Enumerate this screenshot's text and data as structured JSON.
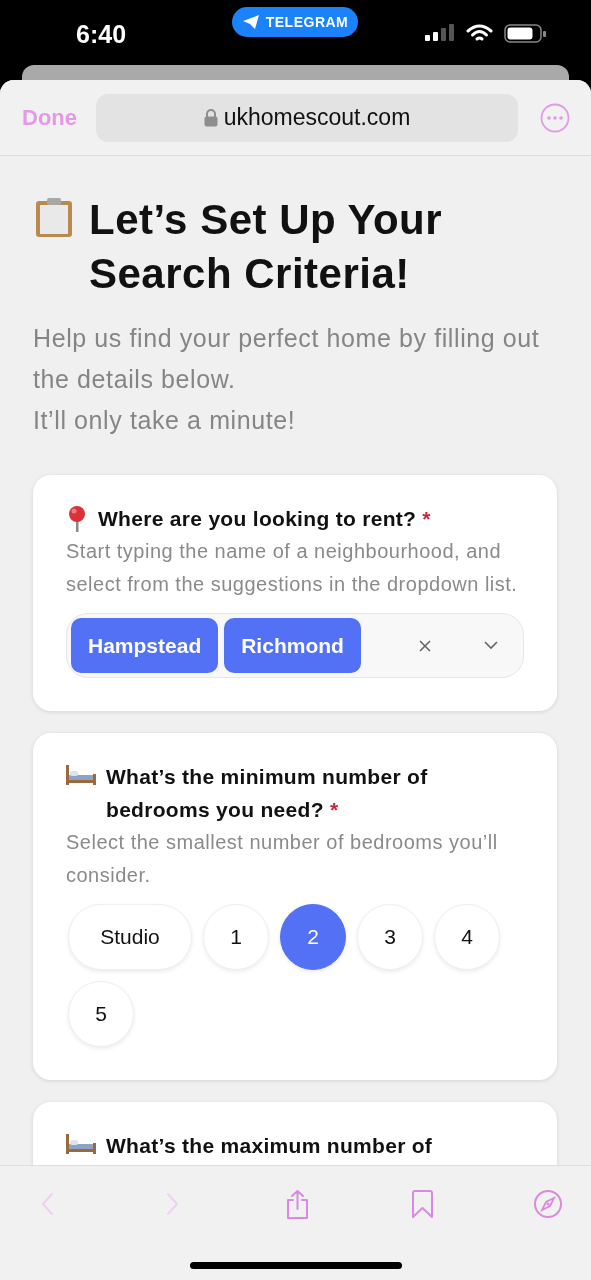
{
  "status_bar": {
    "time": "6:40",
    "app_badge": "TELEGRAM"
  },
  "browser": {
    "done": "Done",
    "url": "ukhomescout.com"
  },
  "page": {
    "title": "Let’s Set Up Your Search Criteria!",
    "intro": [
      "Help us find your perfect home by filling out the details below.",
      "It’ll only take a minute!"
    ]
  },
  "questions": [
    {
      "kind": "tags",
      "label": "Where are you looking to rent?",
      "required_mark": "*",
      "hint": "Start typing the name of a neighbourhood, and select from the suggestions in the dropdown list.",
      "tags": [
        "Hampstead",
        "Richmond"
      ]
    },
    {
      "kind": "choices",
      "label": "What’s the minimum number of bedrooms you need?",
      "required_mark": "*",
      "hint": "Select the smallest number of bedrooms you’ll consider.",
      "options": [
        {
          "label": "Studio",
          "selected": false
        },
        {
          "label": "1",
          "selected": false
        },
        {
          "label": "2",
          "selected": true
        },
        {
          "label": "3",
          "selected": false
        },
        {
          "label": "4",
          "selected": false
        },
        {
          "label": "5",
          "selected": false
        }
      ]
    },
    {
      "kind": "cut",
      "label": "What’s the maximum number of"
    }
  ],
  "toolbar": [
    {
      "kind": "back",
      "disabled": true
    },
    {
      "kind": "forward",
      "disabled": true
    },
    {
      "kind": "share",
      "disabled": false
    },
    {
      "kind": "bookmarks",
      "disabled": false
    },
    {
      "kind": "compass",
      "disabled": false
    }
  ]
}
